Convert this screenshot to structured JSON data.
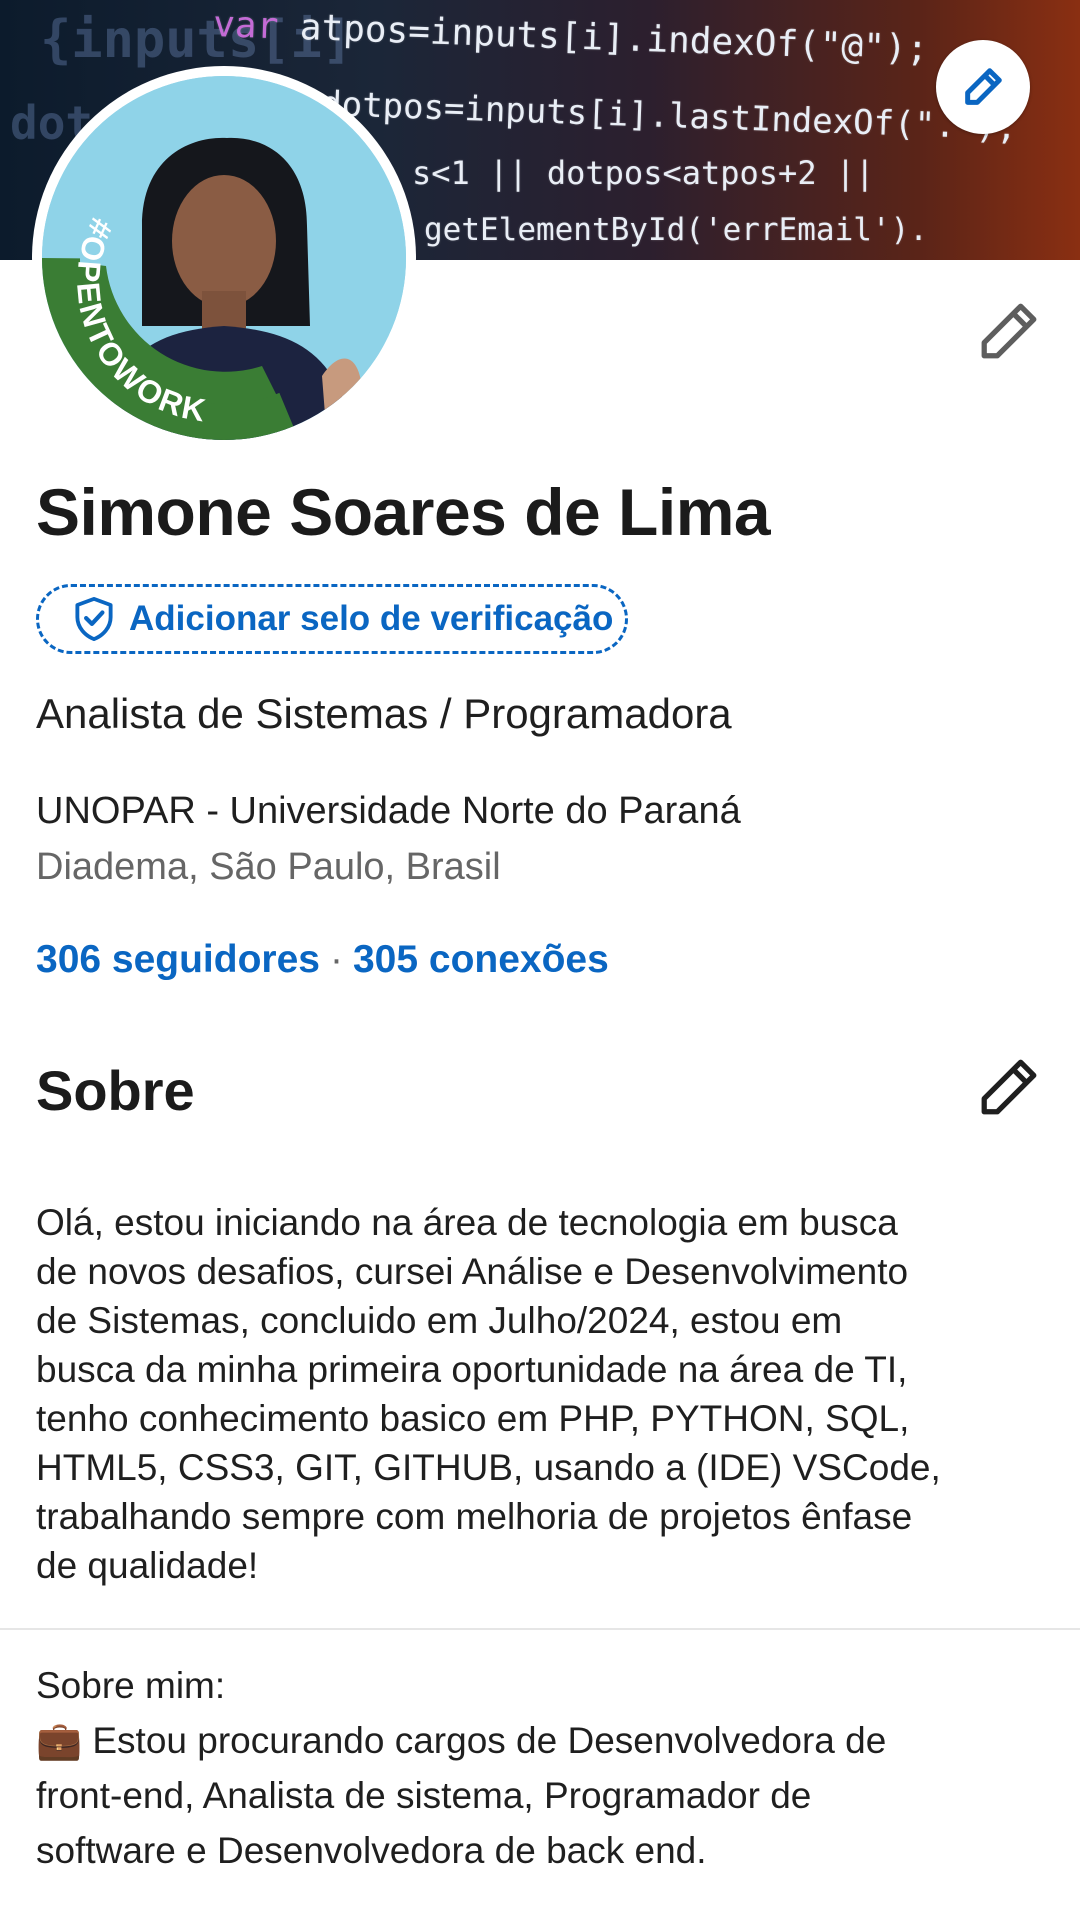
{
  "banner": {
    "code_lines": [
      {
        "prefix": "var",
        "text": " atpos=inputs[i].indexOf(\"@\");"
      },
      {
        "prefix": "",
        "text": "dotpos=inputs[i].lastIndexOf(\".\");"
      },
      {
        "prefix": "",
        "text": "s<1 || dotpos<atpos+2 ||"
      },
      {
        "prefix": "",
        "text": "getElementById('errEmail')."
      }
    ],
    "bg_faint": [
      "{inputs[i]",
      "dot"
    ],
    "edit_icon": "pencil-icon"
  },
  "avatar": {
    "badge_text": "#OPENTOWORK",
    "badge_color": "#3a7d34"
  },
  "profile": {
    "name": "Simone Soares de Lima",
    "verify_label": "Adicionar selo de verificação",
    "headline": "Analista de Sistemas / Programadora",
    "school": "UNOPAR - Universidade Norte do Paraná",
    "location": "Diadema, São Paulo, Brasil",
    "followers": "306 seguidores",
    "separator": "·",
    "connections": "305 conexões"
  },
  "about": {
    "title": "Sobre",
    "lines": [
      "Olá, estou iniciando na área de tecnologia em busca",
      "de novos desafios, cursei Análise e Desenvolvimento",
      "de Sistemas, concluido em Julho/2024, estou em",
      "busca da minha primeira oportunidade na área de TI,",
      "tenho conhecimento basico em PHP, PYTHON, SQL,",
      "HTML5, CSS3, GIT, GITHUB, usando a (IDE) VSCode,",
      "trabalhando sempre com melhoria de projetos ênfase",
      "de qualidade!"
    ],
    "about_me_label": "Sobre mim:",
    "about_me_icon": "💼",
    "about_me_lines": [
      "Estou procurando cargos de Desenvolvedora de",
      "front-end, Analista de sistema, Programador de",
      "software e Desenvolvedora de back end."
    ]
  },
  "colors": {
    "accent": "#0a66c2",
    "text": "#1f1f1f",
    "muted": "#666666"
  }
}
